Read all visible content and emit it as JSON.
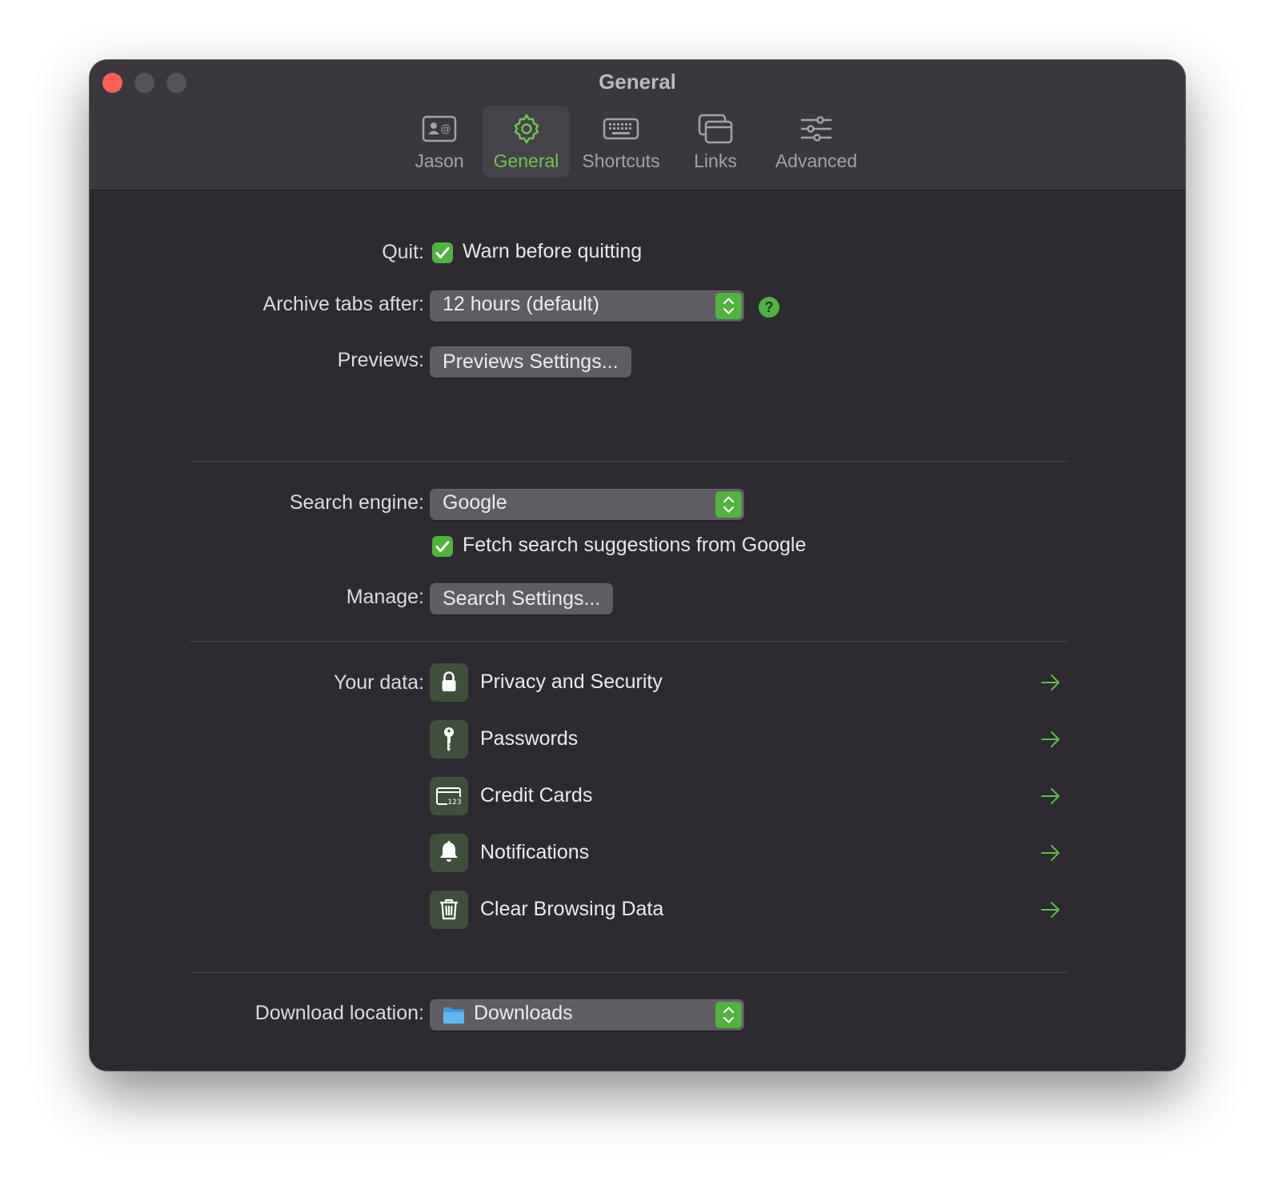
{
  "window": {
    "title": "General"
  },
  "tabs": [
    {
      "label": "Jason",
      "icon": "contact-card-icon"
    },
    {
      "label": "General",
      "icon": "gear-icon",
      "selected": true
    },
    {
      "label": "Shortcuts",
      "icon": "keyboard-icon"
    },
    {
      "label": "Links",
      "icon": "windows-icon"
    },
    {
      "label": "Advanced",
      "icon": "sliders-icon"
    }
  ],
  "general": {
    "quit_label": "Quit:",
    "quit_checkbox": "Warn before quitting",
    "archive_label": "Archive tabs after:",
    "archive_value": "12 hours (default)",
    "help_glyph": "?",
    "previews_label": "Previews:",
    "previews_button": "Previews Settings..."
  },
  "search": {
    "engine_label": "Search engine:",
    "engine_value": "Google",
    "suggestions_checkbox": "Fetch search suggestions from Google",
    "manage_label": "Manage:",
    "manage_button": "Search Settings..."
  },
  "data": {
    "label": "Your data:",
    "items": [
      {
        "label": "Privacy and Security",
        "icon": "lock-icon"
      },
      {
        "label": "Passwords",
        "icon": "key-icon"
      },
      {
        "label": "Credit Cards",
        "icon": "credit-card-icon"
      },
      {
        "label": "Notifications",
        "icon": "bell-icon"
      },
      {
        "label": "Clear Browsing Data",
        "icon": "trash-icon"
      }
    ]
  },
  "download": {
    "label": "Download location:",
    "value": "Downloads"
  },
  "colors": {
    "accent": "#4fb33d",
    "window_bg": "#2d2a31",
    "toolbar_bg": "#3a383d",
    "close_button": "#ff5f57"
  }
}
